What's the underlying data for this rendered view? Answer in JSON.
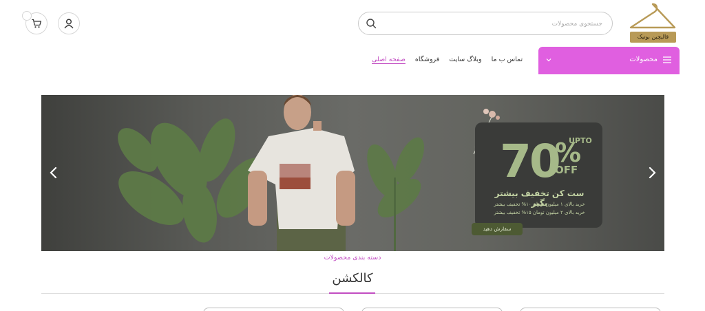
{
  "header": {
    "logo_text": "قالیچین بوتیک",
    "search": {
      "placeholder": "جستجوی محصولات",
      "value": ""
    },
    "cart_count": ""
  },
  "nav": {
    "products_label": "محصولات",
    "links": [
      {
        "label": "صفحه اصلی",
        "active": true
      },
      {
        "label": "فروشگاه",
        "active": false
      },
      {
        "label": "وبلاگ سایت",
        "active": false
      },
      {
        "label": "تماس ب ما",
        "active": false
      }
    ]
  },
  "banner": {
    "percent": "70",
    "percent_sign": "%",
    "upto": "UPTO",
    "off": "OFF",
    "title": "ست کن تخفیف بیشتر بگیر",
    "line1": "خرید بالای ۱ میلیون تومان ۱۰% تخفیف بیشتر",
    "line2": "خرید بالای ۲ میلیون تومان ۱۵% تخفیف بیشتر",
    "cta": "سفارش دهید"
  },
  "section": {
    "subtitle": "دسته بندی محصولات",
    "title": "کالکشن"
  },
  "colors": {
    "accent": "#e05fe0",
    "accent_text": "#c24cc2",
    "promo_green": "#a6b989",
    "cta_green": "#4d5a33"
  },
  "icons": [
    "hanger-logo-icon",
    "search-icon",
    "user-icon",
    "cart-icon",
    "menu-icon",
    "chevron-down-icon",
    "chevron-left-icon",
    "chevron-right-icon"
  ]
}
